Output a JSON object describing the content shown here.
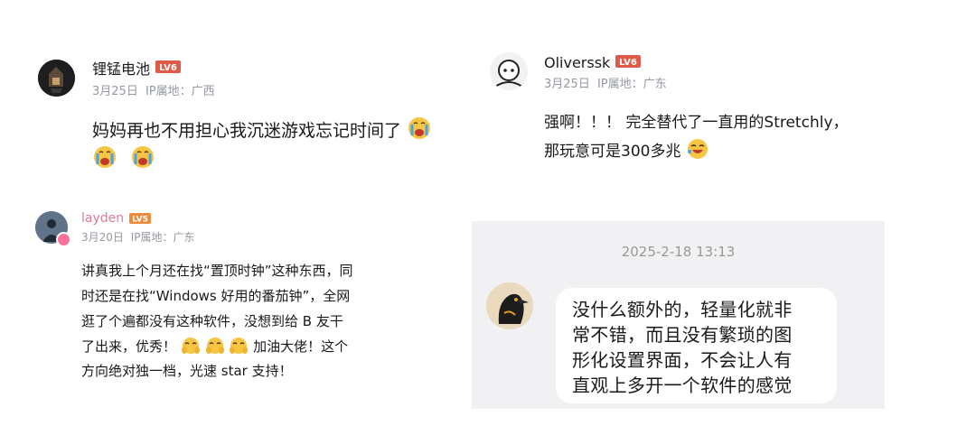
{
  "colors": {
    "accent_level": "#e05a4a",
    "meta_grey": "#9499a0",
    "name_pink": "#e07a93",
    "chat_bg": "#f1f1f4"
  },
  "comments": [
    {
      "username": "锂锰电池",
      "level": "LV6",
      "date": "3月25日",
      "ip": "IP属地：广西",
      "lines": [
        "妈妈再也不用担心我沉迷游戏忘记时间了"
      ],
      "emojis": [
        "crying-emoji",
        "crying-emoji",
        "crying-emoji"
      ]
    },
    {
      "username": "Oliverssk",
      "level": "LV6",
      "date": "3月25日",
      "ip": "IP属地：广东",
      "lines": [
        "强啊！！！ 完全替代了一直用的Stretchly，",
        "那玩意可是300多兆"
      ],
      "emojis": [
        "laughing-emoji"
      ]
    },
    {
      "username": "layden",
      "level": "LV5",
      "date": "3月20日",
      "ip": "IP属地：广东",
      "lines": [
        "讲真我上个月还在找“置顶时钟”这种东西，同",
        "时还是在找“Windows 好用的番茄钟”，全网",
        "逛了个遍都没有这种软件，没想到给 B 友干",
        "了出来，优秀！",
        "加油大佬！这个",
        "方向绝对独一档，光速 star 支持！"
      ],
      "emojis": [
        "cheering-emoji",
        "cheering-emoji",
        "cheering-emoji"
      ]
    }
  ],
  "chat": {
    "timestamp": "2025-2-18 13:13",
    "lines": [
      "没什么额外的，轻量化就非",
      "常不错，而且没有繁琐的图",
      "形化设置界面，不会让人有",
      "直观上多开一个软件的感觉"
    ]
  }
}
